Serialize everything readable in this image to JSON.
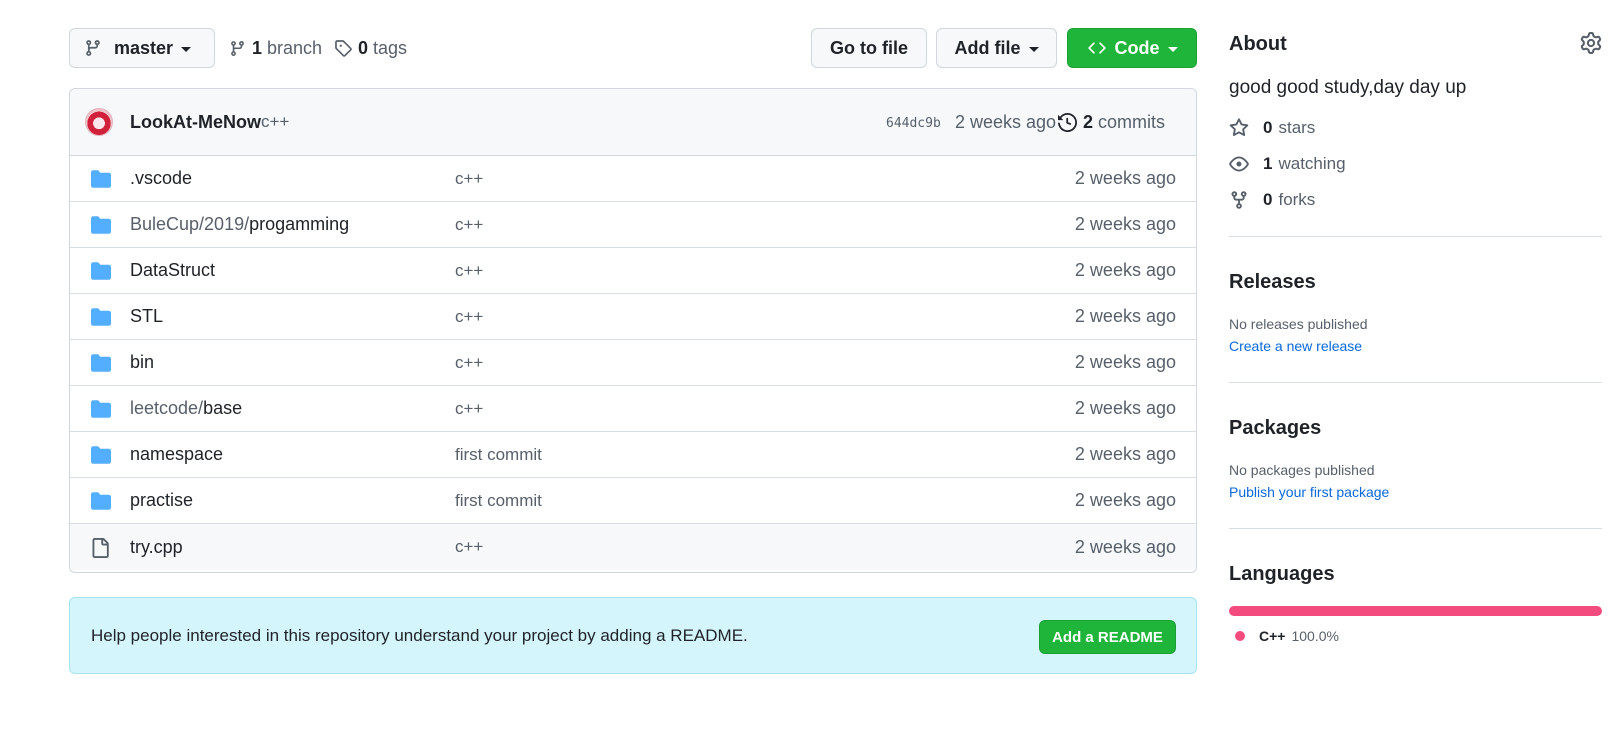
{
  "toolbar": {
    "branch_name": "master",
    "branch_count": "1",
    "branch_label": "branch",
    "tag_count": "0",
    "tag_label": "tags",
    "goto_label": "Go to file",
    "add_label": "Add file",
    "code_label": "Code"
  },
  "commit": {
    "author": "LookAt-MeNow",
    "message": "c++",
    "sha": "644dc9b",
    "time": "2 weeks ago",
    "count": "2",
    "count_label": "commits"
  },
  "files": [
    {
      "type": "folder",
      "dim": "",
      "name": ".vscode",
      "message": "c++",
      "time": "2 weeks ago"
    },
    {
      "type": "folder",
      "dim": "BuleCup/2019/",
      "name": "progamming",
      "message": "c++",
      "time": "2 weeks ago"
    },
    {
      "type": "folder",
      "dim": "",
      "name": "DataStruct",
      "message": "c++",
      "time": "2 weeks ago"
    },
    {
      "type": "folder",
      "dim": "",
      "name": "STL",
      "message": "c++",
      "time": "2 weeks ago"
    },
    {
      "type": "folder",
      "dim": "",
      "name": "bin",
      "message": "c++",
      "time": "2 weeks ago"
    },
    {
      "type": "folder",
      "dim": "leetcode/",
      "name": "base",
      "message": "c++",
      "time": "2 weeks ago"
    },
    {
      "type": "folder",
      "dim": "",
      "name": "namespace",
      "message": "first commit",
      "time": "2 weeks ago"
    },
    {
      "type": "folder",
      "dim": "",
      "name": "practise",
      "message": "first commit",
      "time": "2 weeks ago"
    },
    {
      "type": "file",
      "dim": "",
      "name": "try.cpp",
      "message": "c++",
      "time": "2 weeks ago"
    }
  ],
  "readme": {
    "text": "Help people interested in this repository understand your project by adding a README.",
    "button": "Add a README"
  },
  "about": {
    "title": "About",
    "description": "good good study,day day up",
    "stars_count": "0",
    "stars_label": "stars",
    "watching_count": "1",
    "watching_label": "watching",
    "forks_count": "0",
    "forks_label": "forks"
  },
  "releases": {
    "title": "Releases",
    "note": "No releases published",
    "link": "Create a new release"
  },
  "packages": {
    "title": "Packages",
    "note": "No packages published",
    "link": "Publish your first package"
  },
  "languages": {
    "title": "Languages",
    "items": [
      {
        "name": "C++",
        "percent": "100.0%",
        "color": "#f34b7d"
      }
    ]
  },
  "colors": {
    "accent_green": "#1fb53a",
    "folder_blue": "#54aeff",
    "link_blue": "#0969da",
    "banner_bg": "#d3f5fb"
  }
}
